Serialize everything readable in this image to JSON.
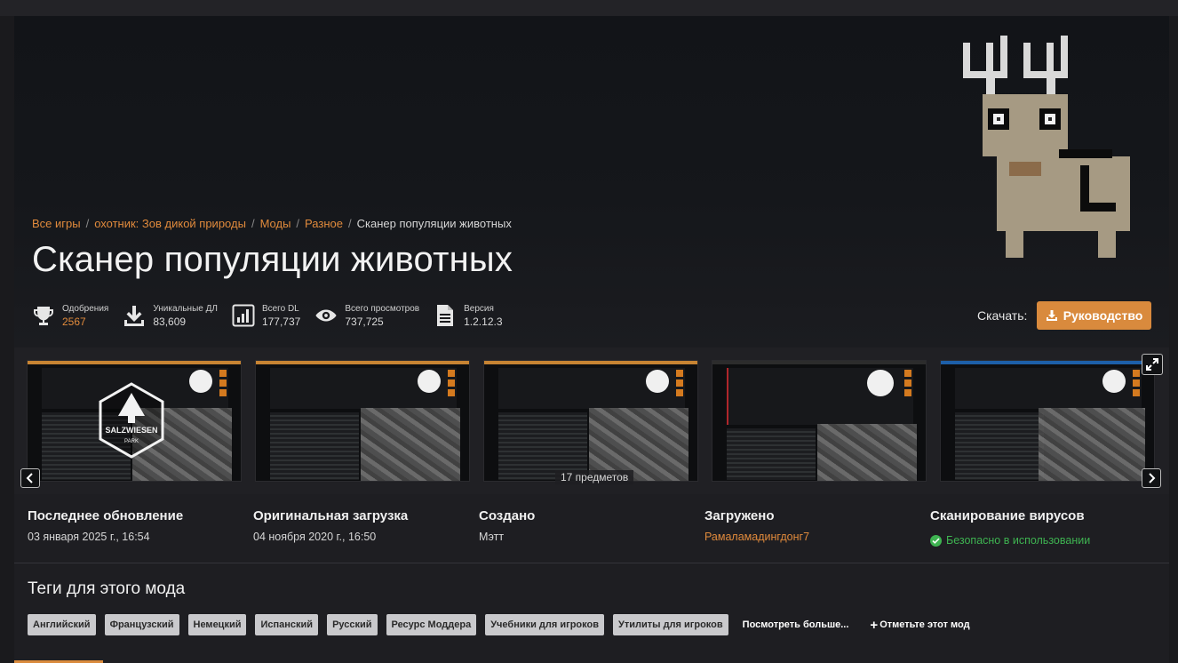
{
  "breadcrumb": {
    "items": [
      "Все игры",
      "охотник: Зов дикой природы",
      "Моды",
      "Разное"
    ],
    "current": "Сканер популяции животных",
    "separator": "/"
  },
  "page_title": "Сканер популяции животных",
  "stats": [
    {
      "icon": "trophy-icon",
      "label": "Одобрения",
      "value": "2567"
    },
    {
      "icon": "download-icon",
      "label": "Уникальные ДЛ",
      "value": "83,609"
    },
    {
      "icon": "bar-chart-icon",
      "label": "Всего DL",
      "value": "177,737"
    },
    {
      "icon": "eye-icon",
      "label": "Всего просмотров",
      "value": "737,725"
    },
    {
      "icon": "document-icon",
      "label": "Версия",
      "value": "1.2.12.3"
    }
  ],
  "download": {
    "label": "Скачать:",
    "button": "Руководство"
  },
  "gallery": {
    "items_count": "17 предметов",
    "logo_text_1": "SALZWIESEN",
    "logo_text_2": "PARK"
  },
  "info": {
    "last_update": {
      "title": "Последнее обновление",
      "value": "03 января 2025 г.,   16:54"
    },
    "original_upload": {
      "title": "Оригинальная загрузка",
      "value": "04 ноября 2020 г.,   16:50"
    },
    "created": {
      "title": "Создано",
      "value": "Мэтт"
    },
    "uploaded": {
      "title": "Загружено",
      "value": "Рамаламадингдонг7"
    },
    "virus_scan": {
      "title": "Сканирование вирусов",
      "value": "Безопасно в использовании"
    }
  },
  "tags": {
    "title": "Теги для этого мода",
    "items": [
      "Английский",
      "Французский",
      "Немецкий",
      "Испанский",
      "Русский",
      "Ресурс Моддера",
      "Учебники для игроков",
      "Утилиты для игроков"
    ],
    "more": "Посмотреть больше...",
    "add": "Отметьте этот мод"
  },
  "colors": {
    "accent": "#d98a3d",
    "link": "#e08a3c",
    "safe": "#3eb351",
    "background": "#1a1a1d"
  }
}
